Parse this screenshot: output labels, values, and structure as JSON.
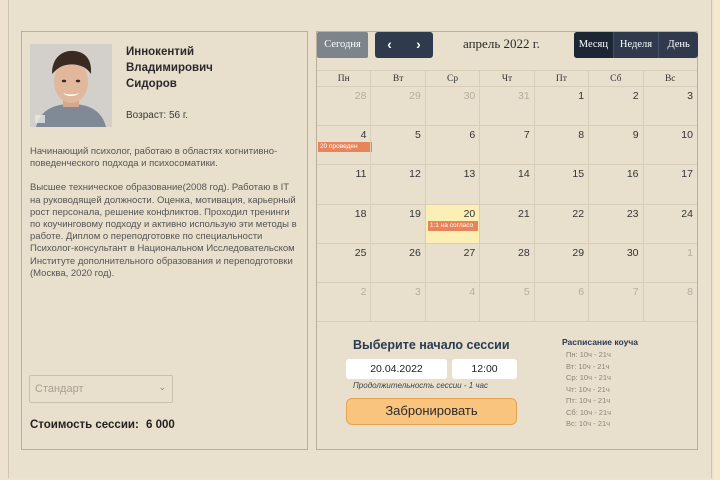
{
  "profile": {
    "name_line1": "Иннокентий",
    "name_line2": "Владимирович",
    "name_line3": "Сидоров",
    "age": "Возраст: 56 г.",
    "bio_p1": "Начинающий психолог, работаю в областях когнитивно-поведенческого подхода и психосоматики.",
    "bio_p2": "Высшее техническое образование(2008 год). Работаю в IT на руководящей должности. Оценка, мотивация, карьерный рост персонала, решение конфликтов. Проходил тренинги по коучинговому подходу и активно использую эти методы в работе. Диплом о переподготовке по специальности Психолог-консультант в Национальном Исследовательском Институте дополнительного образования и переподготовки (Москва, 2020 год).",
    "tariff_value": "Стандарт",
    "price_label": "Стоимость сессии:",
    "price_value": "6 000"
  },
  "calendar": {
    "today_label": "Сегодня",
    "prev_label": "‹",
    "next_label": "›",
    "month_title": "апрель 2022 г.",
    "views": [
      "Месяц",
      "Неделя",
      "День"
    ],
    "active_view": "Месяц",
    "weekdays": [
      "Пн",
      "Вт",
      "Ср",
      "Чт",
      "Пт",
      "Сб",
      "Вс"
    ],
    "weeks": [
      [
        "28",
        "29",
        "30",
        "31",
        "1",
        "2",
        "3"
      ],
      [
        "4",
        "5",
        "6",
        "7",
        "8",
        "9",
        "10"
      ],
      [
        "11",
        "12",
        "13",
        "14",
        "15",
        "16",
        "17"
      ],
      [
        "18",
        "19",
        "20",
        "21",
        "22",
        "23",
        "24"
      ],
      [
        "25",
        "26",
        "27",
        "28",
        "29",
        "30",
        "1"
      ],
      [
        "2",
        "3",
        "4",
        "5",
        "6",
        "7",
        "8"
      ]
    ],
    "event_1": "20 проведен",
    "event_2": "1:1 на согласо",
    "event_color": "#e8845a",
    "today_color": "#fbefb5"
  },
  "booking": {
    "title": "Выберите начало сессии",
    "date_value": "20.04.2022",
    "time_value": "12:00",
    "duration": "Продолжительность сессии - 1 час",
    "button_label": "Забронировать"
  },
  "schedule": {
    "title": "Расписание коуча",
    "rows": [
      "Пн: 10ч - 21ч",
      "Вт: 10ч - 21ч",
      "Ср: 10ч - 21ч",
      "Чт: 10ч - 21ч",
      "Пт: 10ч - 21ч",
      "Сб: 10ч - 21ч",
      "Вс: 10ч - 21ч"
    ]
  }
}
